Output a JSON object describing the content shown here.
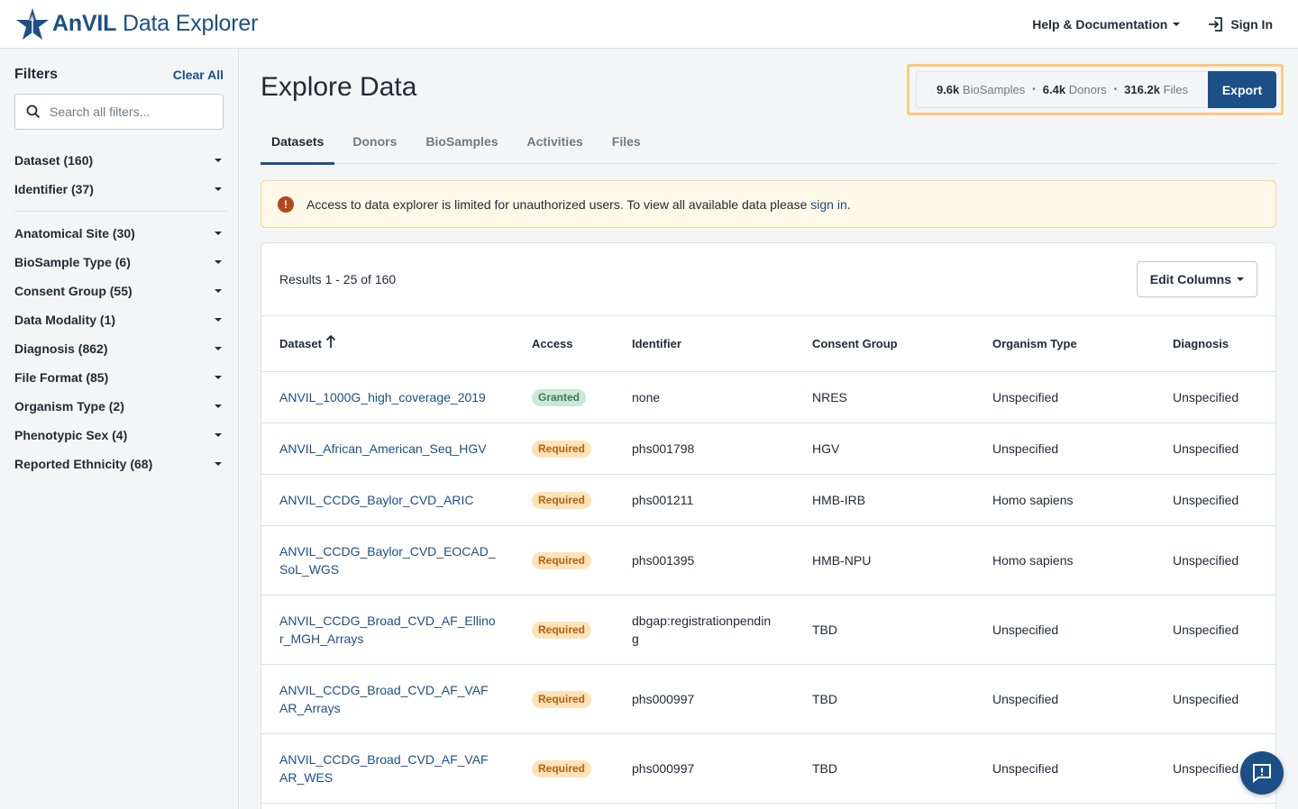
{
  "header": {
    "logo_text_bold": "AnVIL",
    "logo_text": "Data Explorer",
    "help_label": "Help & Documentation",
    "signin_label": "Sign In"
  },
  "sidebar": {
    "title": "Filters",
    "clear_all": "Clear All",
    "search_placeholder": "Search all filters...",
    "group1": [
      {
        "label": "Dataset (160)"
      },
      {
        "label": "Identifier (37)"
      }
    ],
    "group2": [
      {
        "label": "Anatomical Site (30)"
      },
      {
        "label": "BioSample Type (6)"
      },
      {
        "label": "Consent Group (55)"
      },
      {
        "label": "Data Modality (1)"
      },
      {
        "label": "Diagnosis (862)"
      },
      {
        "label": "File Format (85)"
      },
      {
        "label": "Organism Type (2)"
      },
      {
        "label": "Phenotypic Sex (4)"
      },
      {
        "label": "Reported Ethnicity (68)"
      }
    ]
  },
  "main": {
    "title": "Explore Data",
    "summary": {
      "biosamples_num": "9.6k",
      "biosamples_label": "BioSamples",
      "donors_num": "6.4k",
      "donors_label": "Donors",
      "files_num": "316.2k",
      "files_label": "Files",
      "sep": "•"
    },
    "export_label": "Export",
    "tabs": [
      {
        "label": "Datasets"
      },
      {
        "label": "Donors"
      },
      {
        "label": "BioSamples"
      },
      {
        "label": "Activities"
      },
      {
        "label": "Files"
      }
    ],
    "alert": {
      "text": "Access to data explorer is limited for unauthorized users. To view all available data please ",
      "link": "sign in",
      "end": "."
    },
    "results_text": "Results 1 - 25 of 160",
    "edit_columns_label": "Edit Columns",
    "columns": [
      "Dataset",
      "Access",
      "Identifier",
      "Consent Group",
      "Organism Type",
      "Diagnosis"
    ],
    "sort_arrow": "🡑",
    "rows": [
      {
        "dataset": "ANVIL_1000G_high_coverage_2019",
        "access": "Granted",
        "identifier": "none",
        "consent": "NRES",
        "organism": "Unspecified",
        "diagnosis": "Unspecified"
      },
      {
        "dataset": "ANVIL_African_American_Seq_HGV",
        "access": "Required",
        "identifier": "phs001798",
        "consent": "HGV",
        "organism": "Unspecified",
        "diagnosis": "Unspecified"
      },
      {
        "dataset": "ANVIL_CCDG_Baylor_CVD_ARIC",
        "access": "Required",
        "identifier": "phs001211",
        "consent": "HMB-IRB",
        "organism": "Homo sapiens",
        "diagnosis": "Unspecified"
      },
      {
        "dataset": "ANVIL_CCDG_Baylor_CVD_EOCAD_SoL_WGS",
        "access": "Required",
        "identifier": "phs001395",
        "consent": "HMB-NPU",
        "organism": "Homo sapiens",
        "diagnosis": "Unspecified"
      },
      {
        "dataset": "ANVIL_CCDG_Broad_CVD_AF_Ellinor_MGH_Arrays",
        "access": "Required",
        "identifier": "dbgap:registrationpending",
        "consent": "TBD",
        "organism": "Unspecified",
        "diagnosis": "Unspecified"
      },
      {
        "dataset": "ANVIL_CCDG_Broad_CVD_AF_VAFAR_Arrays",
        "access": "Required",
        "identifier": "phs000997",
        "consent": "TBD",
        "organism": "Unspecified",
        "diagnosis": "Unspecified"
      },
      {
        "dataset": "ANVIL_CCDG_Broad_CVD_AF_VAFAR_WES",
        "access": "Required",
        "identifier": "phs000997",
        "consent": "TBD",
        "organism": "Unspecified",
        "diagnosis": "Unspecified"
      }
    ]
  },
  "colors": {
    "brand": "#1c4f86",
    "granted_bg": "#cbe8d6",
    "required_bg": "#fde3b8",
    "highlight_border": "#fcc97a"
  },
  "icons": [
    "anvil-star-logo-icon",
    "chevron-down-icon",
    "sign-in-icon",
    "search-icon",
    "alert-icon",
    "sort-arrow-icon",
    "chat-feedback-icon"
  ]
}
